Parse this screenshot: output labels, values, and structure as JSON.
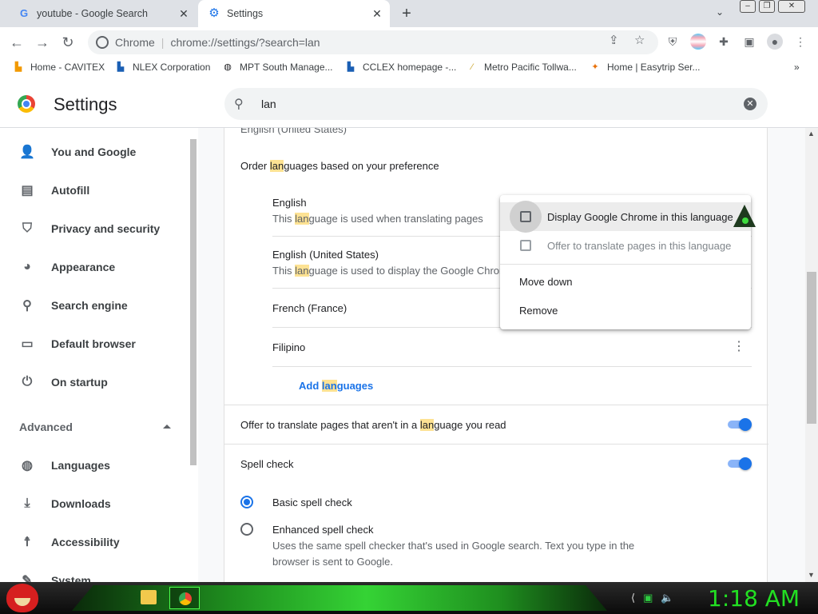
{
  "tabs": [
    {
      "title": "youtube - Google Search",
      "icon": "google-icon"
    },
    {
      "title": "Settings",
      "icon": "settings-gear-icon",
      "active": true
    }
  ],
  "omnibox": {
    "scheme_label": "Chrome",
    "url": "chrome://settings/?search=lan"
  },
  "bookmarks": [
    "Home - CAVITEX",
    "NLEX Corporation",
    "MPT South Manage...",
    "CCLEX homepage -...",
    "Metro Pacific Tollwa...",
    "Home | Easytrip Ser..."
  ],
  "settings": {
    "title": "Settings",
    "search_value": "lan"
  },
  "sidebar": {
    "items": [
      {
        "label": "You and Google",
        "icon": "person-icon"
      },
      {
        "label": "Autofill",
        "icon": "clipboard-icon"
      },
      {
        "label": "Privacy and security",
        "icon": "shield-icon"
      },
      {
        "label": "Appearance",
        "icon": "palette-icon"
      },
      {
        "label": "Search engine",
        "icon": "search-icon"
      },
      {
        "label": "Default browser",
        "icon": "browser-icon"
      },
      {
        "label": "On startup",
        "icon": "power-icon"
      }
    ],
    "advanced_label": "Advanced",
    "advanced_items": [
      {
        "label": "Languages",
        "icon": "globe-icon"
      },
      {
        "label": "Downloads",
        "icon": "download-icon"
      },
      {
        "label": "Accessibility",
        "icon": "accessibility-icon"
      },
      {
        "label": "System",
        "icon": "wrench-icon"
      }
    ]
  },
  "languages": {
    "top_partial": "English (United States)",
    "order_label_pre": "Order ",
    "order_label_hl": "lan",
    "order_label_post": "guages based on your preference",
    "list": [
      {
        "name": "English",
        "desc_pre": "This ",
        "desc_hl": "lan",
        "desc_post": "guage is used when translating pages"
      },
      {
        "name": "English (United States)",
        "desc_pre": "This ",
        "desc_hl": "lan",
        "desc_post": "guage is used to display the Google Chrom"
      },
      {
        "name": "French (France)"
      },
      {
        "name": "Filipino"
      }
    ],
    "add_pre": "Add ",
    "add_hl": "lan",
    "add_post": "guages",
    "offer_pre": "Offer to translate pages that aren't in a ",
    "offer_hl": "lan",
    "offer_post": "guage you read",
    "offer_enabled": true
  },
  "spell_check": {
    "label": "Spell check",
    "enabled": true,
    "basic_label": "Basic spell check",
    "enhanced_label": "Enhanced spell check",
    "enhanced_desc_1": "Uses the same spell checker that's used in Google search. Text you type in the",
    "enhanced_desc_2": "browser is sent to Google.",
    "selected": "basic"
  },
  "context_menu": {
    "display_label": "Display Google Chrome in this language",
    "offer_label": "Offer to translate pages in this language",
    "move_down": "Move down",
    "remove": "Remove"
  },
  "taskbar": {
    "clock": "1:18 AM"
  },
  "colors": {
    "accent": "#1a73e8",
    "highlight": "#fde293",
    "clock": "#22e022"
  }
}
